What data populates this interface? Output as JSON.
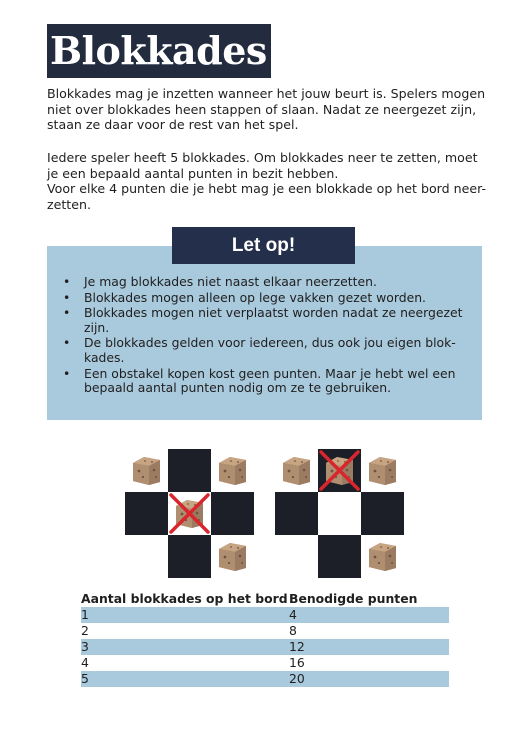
{
  "title": "Blokkades",
  "paragraphs": {
    "p1": "Blokkades mag je inzetten wanneer het jouw beurt is. Spelers mogen niet over blokkades heen stappen of slaan. Nadat ze neergezet zijn, staan ze daar voor de rest van het spel.",
    "p2": "Iedere speler heeft 5 blokkades. Om blokkades neer te zetten, moet je een bepaald aantal punten in bezit hebben.",
    "p3": "Voor elke 4 punten die je hebt mag je een blokkade op het bord neer-zetten."
  },
  "note": {
    "heading": "Let op!",
    "bullet": "•",
    "items": [
      "Je mag blokkades niet naast elkaar neerzetten.",
      "Blokkades mogen alleen op lege vakken gezet worden.",
      "Blokkades mogen niet verplaatst worden nadat ze neergezet zijn.",
      "De blokkades gelden voor iedereen, dus ook jou eigen blok-kades.",
      "Een obstakel kopen kost geen punten. Maar je hebt wel een bepaald aantal punten nodig om ze te gebruiken."
    ]
  },
  "diagrams": {
    "colors": {
      "dark_square": "#1c1e28",
      "cross": "#d9262c",
      "block_light": "#c7a583",
      "block_dark": "#8c6d55"
    },
    "block_icon": "stone-block-icon",
    "cross_icon": "red-cross-icon"
  },
  "table": {
    "headers": [
      "Aantal blokkades op het bord",
      "Benodigde punten"
    ],
    "rows": [
      [
        "1",
        "4"
      ],
      [
        "2",
        "8"
      ],
      [
        "3",
        "12"
      ],
      [
        "4",
        "16"
      ],
      [
        "5",
        "20"
      ]
    ],
    "shade_color": "#a9c9dc"
  }
}
